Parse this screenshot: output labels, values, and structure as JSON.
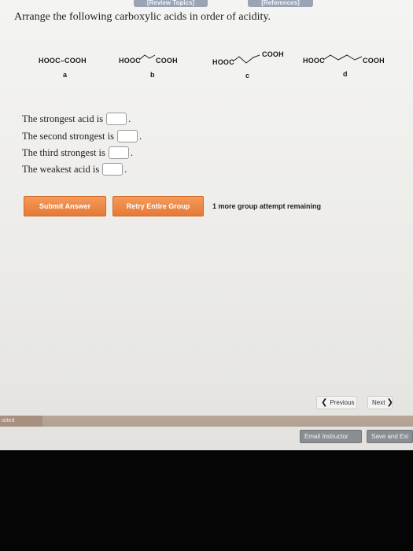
{
  "tabs": {
    "review_topics": "[Review Topics]",
    "references": "[References]"
  },
  "question": "Arrange the following carboxylic acids in order of acidity.",
  "molecules": [
    {
      "formula": "HOOC–COOH",
      "letter": "a"
    },
    {
      "left": "HOOC",
      "right": "COOH",
      "letter": "b"
    },
    {
      "left": "HOOC",
      "top": "COOH",
      "letter": "c"
    },
    {
      "left": "HOOC",
      "right": "COOH",
      "letter": "d"
    }
  ],
  "answers": [
    {
      "label": "The strongest acid is",
      "value": ""
    },
    {
      "label": "The second strongest is",
      "value": ""
    },
    {
      "label": "The third strongest is",
      "value": ""
    },
    {
      "label": "The weakest acid is",
      "value": ""
    }
  ],
  "buttons": {
    "submit": "Submit Answer",
    "retry": "Retry Entire Group",
    "attempts": "1 more group attempt remaining",
    "previous": "Previous",
    "next": "Next"
  },
  "footer": {
    "left_label": "isited",
    "email": "Email Instructor",
    "save": "Save and Exi"
  }
}
